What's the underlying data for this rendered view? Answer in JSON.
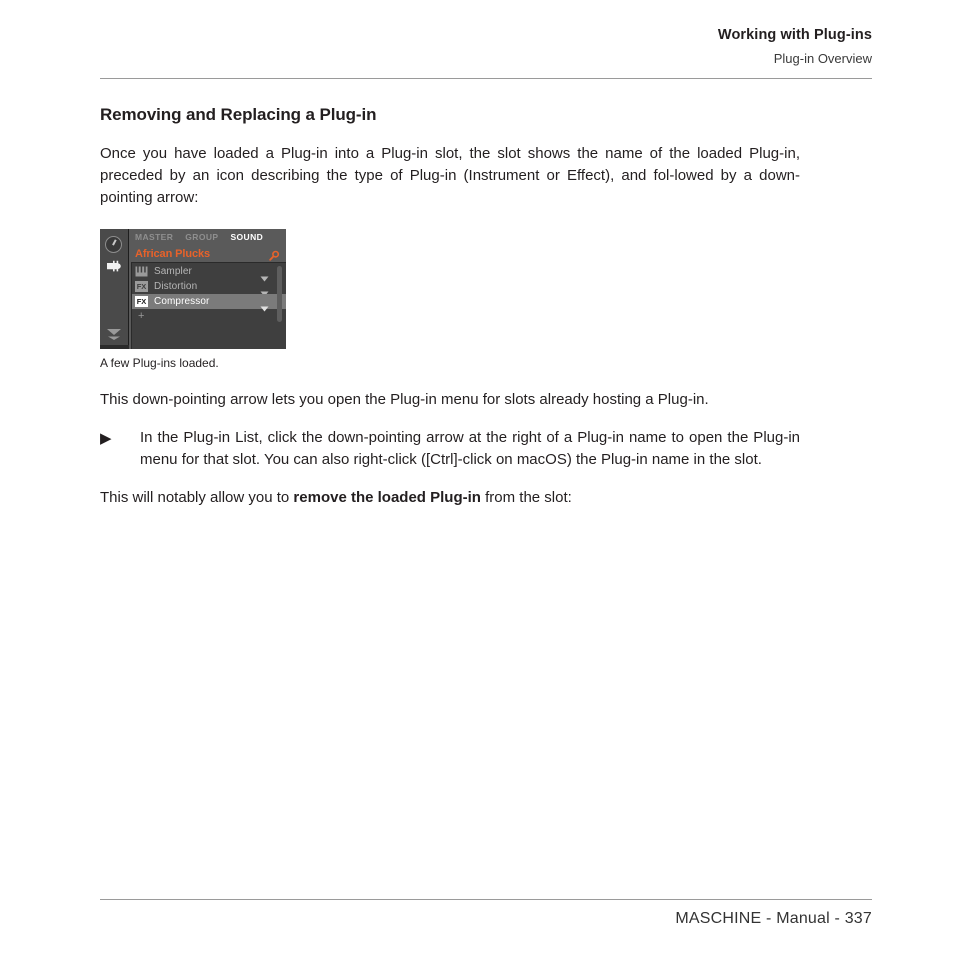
{
  "header": {
    "title": "Working with Plug-ins",
    "subtitle": "Plug-in Overview"
  },
  "footer": {
    "text": "MASCHINE - Manual - 337"
  },
  "content": {
    "section_title": "Removing and Replacing a Plug-in",
    "intro_paragraph": "Once you have loaded a Plug-in into a Plug-in slot, the slot shows the name of the loaded Plug-in, preceded by an icon describing the type of Plug-in (Instrument or Effect), and fol-lowed by a down-pointing arrow:",
    "figure_caption": "A few Plug-ins loaded.",
    "after_figure_paragraph": "This down-pointing arrow lets you open the Plug-in menu for slots already hosting a Plug-in.",
    "bullet": {
      "marker": "▶",
      "text": "In the Plug-in List, click the down-pointing arrow at the right of a Plug-in name to open the Plug-in menu for that slot. You can also right-click ([Ctrl]-click on macOS) the Plug-in name in the slot."
    },
    "closing": {
      "before": "This will notably allow you to ",
      "bold": "remove the loaded Plug-in",
      "after": " from the slot:"
    }
  },
  "figure_widget": {
    "tabs": [
      {
        "label": "MASTER",
        "active": false
      },
      {
        "label": "GROUP",
        "active": false
      },
      {
        "label": "SOUND",
        "active": true
      }
    ],
    "sound_name": "African Plucks",
    "search_icon": "magnifier-icon",
    "strip_icons": [
      "knob-icon",
      "plug-icon",
      "collapse-arrow-icon"
    ],
    "slots": [
      {
        "badge": "keyboard-icon",
        "badge_text": "",
        "label": "Sampler",
        "selected": false
      },
      {
        "badge": "fx-icon",
        "badge_text": "FX",
        "label": "Distortion",
        "selected": false
      },
      {
        "badge": "fx-icon",
        "badge_text": "FX",
        "label": "Compressor",
        "selected": true
      }
    ],
    "add_slot_label": "+",
    "accent_color": "#e8622a"
  }
}
